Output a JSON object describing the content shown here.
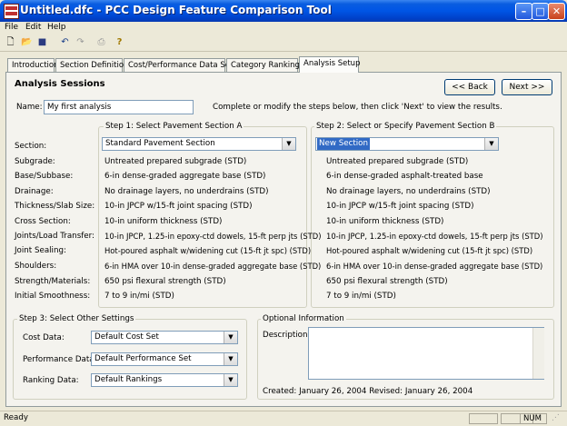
{
  "window": {
    "title": "Untitled.dfc - PCC Design Feature Comparison Tool"
  },
  "menu": [
    "File",
    "Edit",
    "Help"
  ],
  "tabs": [
    "Introduction",
    "Section Definition",
    "Cost/Performance Data Sets",
    "Category Rankings",
    "Analysis Setup"
  ],
  "page_title": "Analysis Sessions",
  "nav": {
    "back_label": "<< Back",
    "next_label": "Next >>"
  },
  "name_label": "Name:",
  "name_value": "My first analysis",
  "instructions": "Complete or modify the steps below, then click 'Next' to view the results.",
  "step1": {
    "legend": "Step 1: Select Pavement Section A",
    "section": "Standard Pavement Section"
  },
  "step2": {
    "legend": "Step 2: Select or Specify Pavement Section B",
    "section": "New Section"
  },
  "rows": [
    {
      "label": "Section:",
      "a": "",
      "b": ""
    },
    {
      "label": "Subgrade:",
      "a": "Untreated prepared subgrade (STD)",
      "b": "Untreated prepared subgrade (STD)"
    },
    {
      "label": "Base/Subbase:",
      "a": "6-in dense-graded aggregate base (STD)",
      "b": "6-in dense-graded asphalt-treated base"
    },
    {
      "label": "Drainage:",
      "a": "No drainage layers, no underdrains (STD)",
      "b": "No drainage layers, no underdrains (STD)"
    },
    {
      "label": "Thickness/Slab Size:",
      "a": "10-in JPCP w/15-ft joint spacing (STD)",
      "b": "10-in JPCP w/15-ft joint spacing (STD)"
    },
    {
      "label": "Cross Section:",
      "a": "10-in uniform thickness (STD)",
      "b": "10-in uniform thickness (STD)"
    },
    {
      "label": "Joints/Load Transfer:",
      "a": "10-in JPCP, 1.25-in epoxy-ctd dowels, 15-ft perp jts (STD)",
      "b": "10-in JPCP, 1.25-in epoxy-ctd dowels, 15-ft perp jts (STD)"
    },
    {
      "label": "Joint Sealing:",
      "a": "Hot-poured asphalt w/widening cut (15-ft jt spc) (STD)",
      "b": "Hot-poured asphalt w/widening cut (15-ft jt spc) (STD)"
    },
    {
      "label": "Shoulders:",
      "a": "6-in HMA over 10-in dense-graded aggregate base (STD)",
      "b": "6-in HMA over 10-in dense-graded aggregate base (STD)"
    },
    {
      "label": "Strength/Materials:",
      "a": "650 psi flexural strength (STD)",
      "b": "650 psi flexural strength (STD)"
    },
    {
      "label": "Initial Smoothness:",
      "a": "7 to 9 in/mi (STD)",
      "b": "7 to 9 in/mi (STD)"
    }
  ],
  "step3": {
    "legend": "Step 3: Select Other Settings",
    "cost_label": "Cost Data:",
    "cost_value": "Default Cost Set",
    "perf_label": "Performance Data:",
    "perf_value": "Default Performance Set",
    "rank_label": "Ranking Data:",
    "rank_value": "Default Rankings"
  },
  "optional": {
    "legend": "Optional Information",
    "description_label": "Description:",
    "description_value": "",
    "dates": "Created: January 26, 2004  Revised: January 26, 2004"
  },
  "status": {
    "text": "Ready",
    "num": "NUM"
  }
}
